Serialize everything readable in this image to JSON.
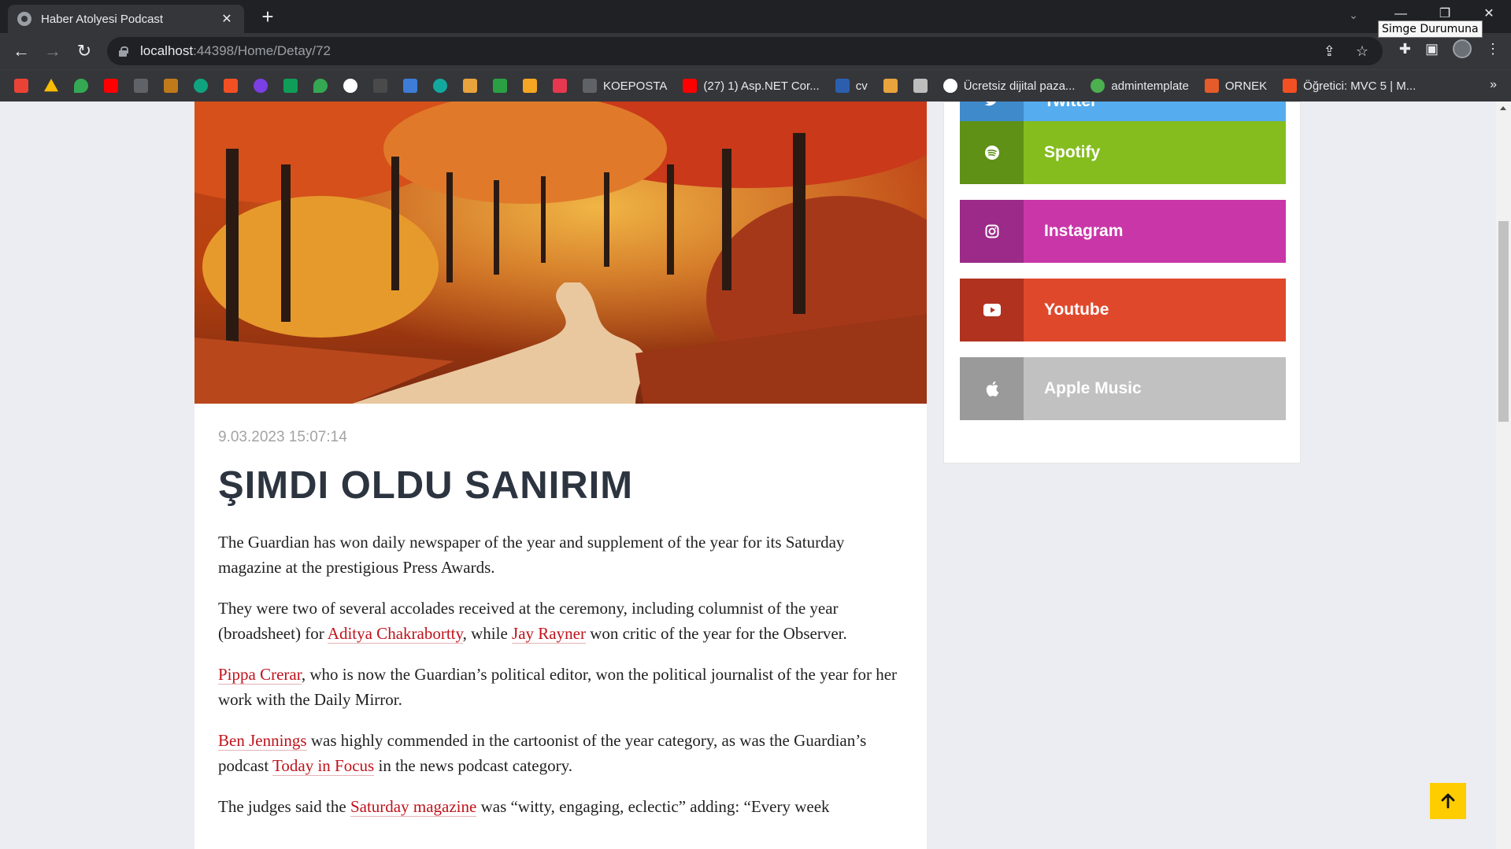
{
  "browser": {
    "tab_title": "Haber Atolyesi Podcast",
    "tab_close": "✕",
    "new_tab": "+",
    "tooltip": "Simge Durumuna",
    "url_host": "localhost",
    "url_path": ":44398/Home/Detay/72",
    "bookmarks": [
      "KOEPOSTA",
      "(27) 1) Asp.NET Cor...",
      "cv",
      "Ücretsiz dijital paza...",
      "admintemplate",
      "ORNEK",
      "Öğretici: MVC 5 | M..."
    ],
    "bookmarks_more": "»"
  },
  "article": {
    "date": "9.03.2023 15:07:14",
    "title": "ŞIMDI OLDU SANIRIM",
    "p1": "The Guardian has won daily newspaper of the year and supplement of the year for its Saturday magazine at the prestigious Press Awards.",
    "p2_a": "They were two of several accolades received at the ceremony, including columnist of the year (broadsheet) for ",
    "p2_link1": "Aditya Chakrabortty",
    "p2_b": ", while ",
    "p2_link2": "Jay Rayner",
    "p2_c": " won critic of the year for the Observer.",
    "p3_link": "Pippa Crerar",
    "p3_text": ", who is now the Guardian’s political editor, won the political journalist of the year for her work with the Daily Mirror.",
    "p4_link1": "Ben Jennings",
    "p4_a": " was highly commended in the cartoonist of the year category, as was the Guardian’s podcast ",
    "p4_link2": "Today in Focus",
    "p4_b": " in the news podcast category.",
    "p5_a": "The judges said the ",
    "p5_link": "Saturday magazine",
    "p5_b": " was “witty, engaging, eclectic” adding: “Every week"
  },
  "social": [
    {
      "label": "Twitter",
      "icon": "twitter-icon",
      "dark": "#3f8acb",
      "light": "#55acee"
    },
    {
      "label": "Spotify",
      "icon": "spotify-icon",
      "dark": "#5e9116",
      "light": "#84bd1d"
    },
    {
      "label": "Instagram",
      "icon": "instagram-icon",
      "dark": "#9b2a88",
      "light": "#c936a8"
    },
    {
      "label": "Youtube",
      "icon": "youtube-icon",
      "dark": "#b0321f",
      "light": "#e0482c"
    },
    {
      "label": "Apple Music",
      "icon": "apple-icon",
      "dark": "#9a9a9a",
      "light": "#c1c1c1"
    }
  ]
}
